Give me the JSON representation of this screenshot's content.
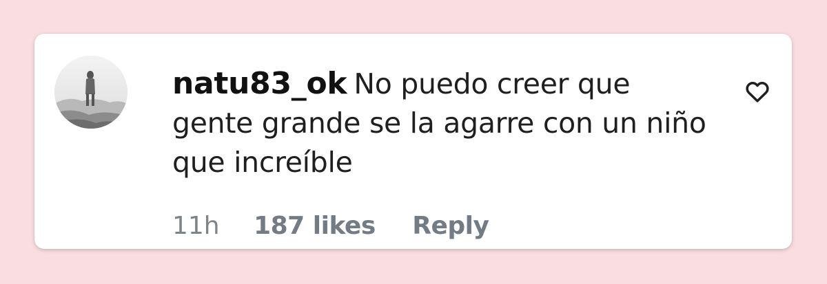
{
  "comment": {
    "username": "natu83_ok",
    "text": "No puedo creer que gente grande se la agarre con un niño que increíble",
    "time": "11h",
    "likes": "187 likes",
    "reply_label": "Reply"
  },
  "icons": {
    "like": "heart-outline-icon",
    "avatar": "profile-photo"
  },
  "colors": {
    "background": "#fadde1",
    "card": "#ffffff",
    "text": "#1f1f1f",
    "meta": "#737c85"
  }
}
